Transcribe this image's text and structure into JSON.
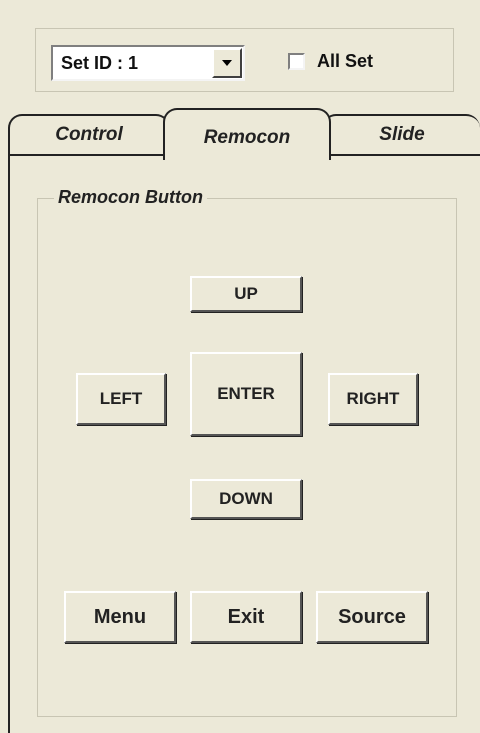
{
  "set_id": {
    "label": "Set ID :",
    "value": "1"
  },
  "all_set": {
    "label": "All Set",
    "checked": false
  },
  "tabs": [
    {
      "label": "Control",
      "active": false
    },
    {
      "label": "Remocon",
      "active": true
    },
    {
      "label": "Slide",
      "active": false
    }
  ],
  "group": {
    "title": "Remocon Button"
  },
  "buttons": {
    "up": "UP",
    "left": "LEFT",
    "enter": "ENTER",
    "right": "RIGHT",
    "down": "DOWN",
    "menu": "Menu",
    "exit": "Exit",
    "source": "Source"
  }
}
